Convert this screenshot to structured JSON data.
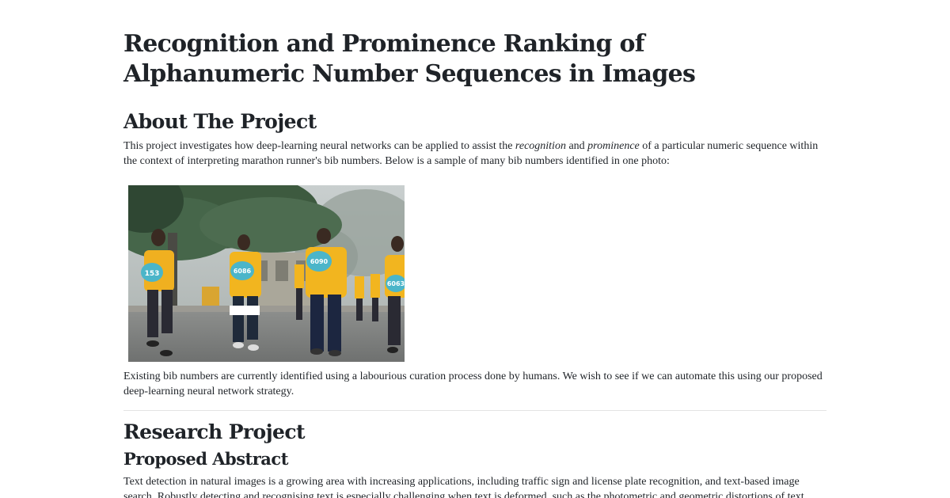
{
  "document": {
    "title": "Recognition and Prominence Ranking of Alphanumeric Number Sequences in Images",
    "about": {
      "heading": "About The Project",
      "paragraph": {
        "part1": "This project investigates how deep-learning neural networks can be applied to assist the ",
        "em1": "recognition",
        "part2": " and ",
        "em2": "prominence",
        "part3": " of a particular numeric sequence within the context of interpreting marathon runner's bib numbers. Below is a sample of many bib numbers identified in one photo:"
      },
      "photo": {
        "bibs": [
          "153",
          "6086",
          "6090",
          "6063"
        ]
      },
      "after_photo": "Existing bib numbers are currently identified using a labourious curation process done by humans. We wish to see if we can automate this using our proposed deep-learning neural network strategy."
    },
    "research": {
      "heading": "Research Project",
      "subheading": "Proposed Abstract",
      "abstract": "Text detection in natural images is a growing area with increasing applications, including traffic sign and license plate recognition, and text-based image search. Robustly detecting and recognising text is especially challenging when text is deformed, such as the photometric and geometric distortions of text"
    }
  }
}
